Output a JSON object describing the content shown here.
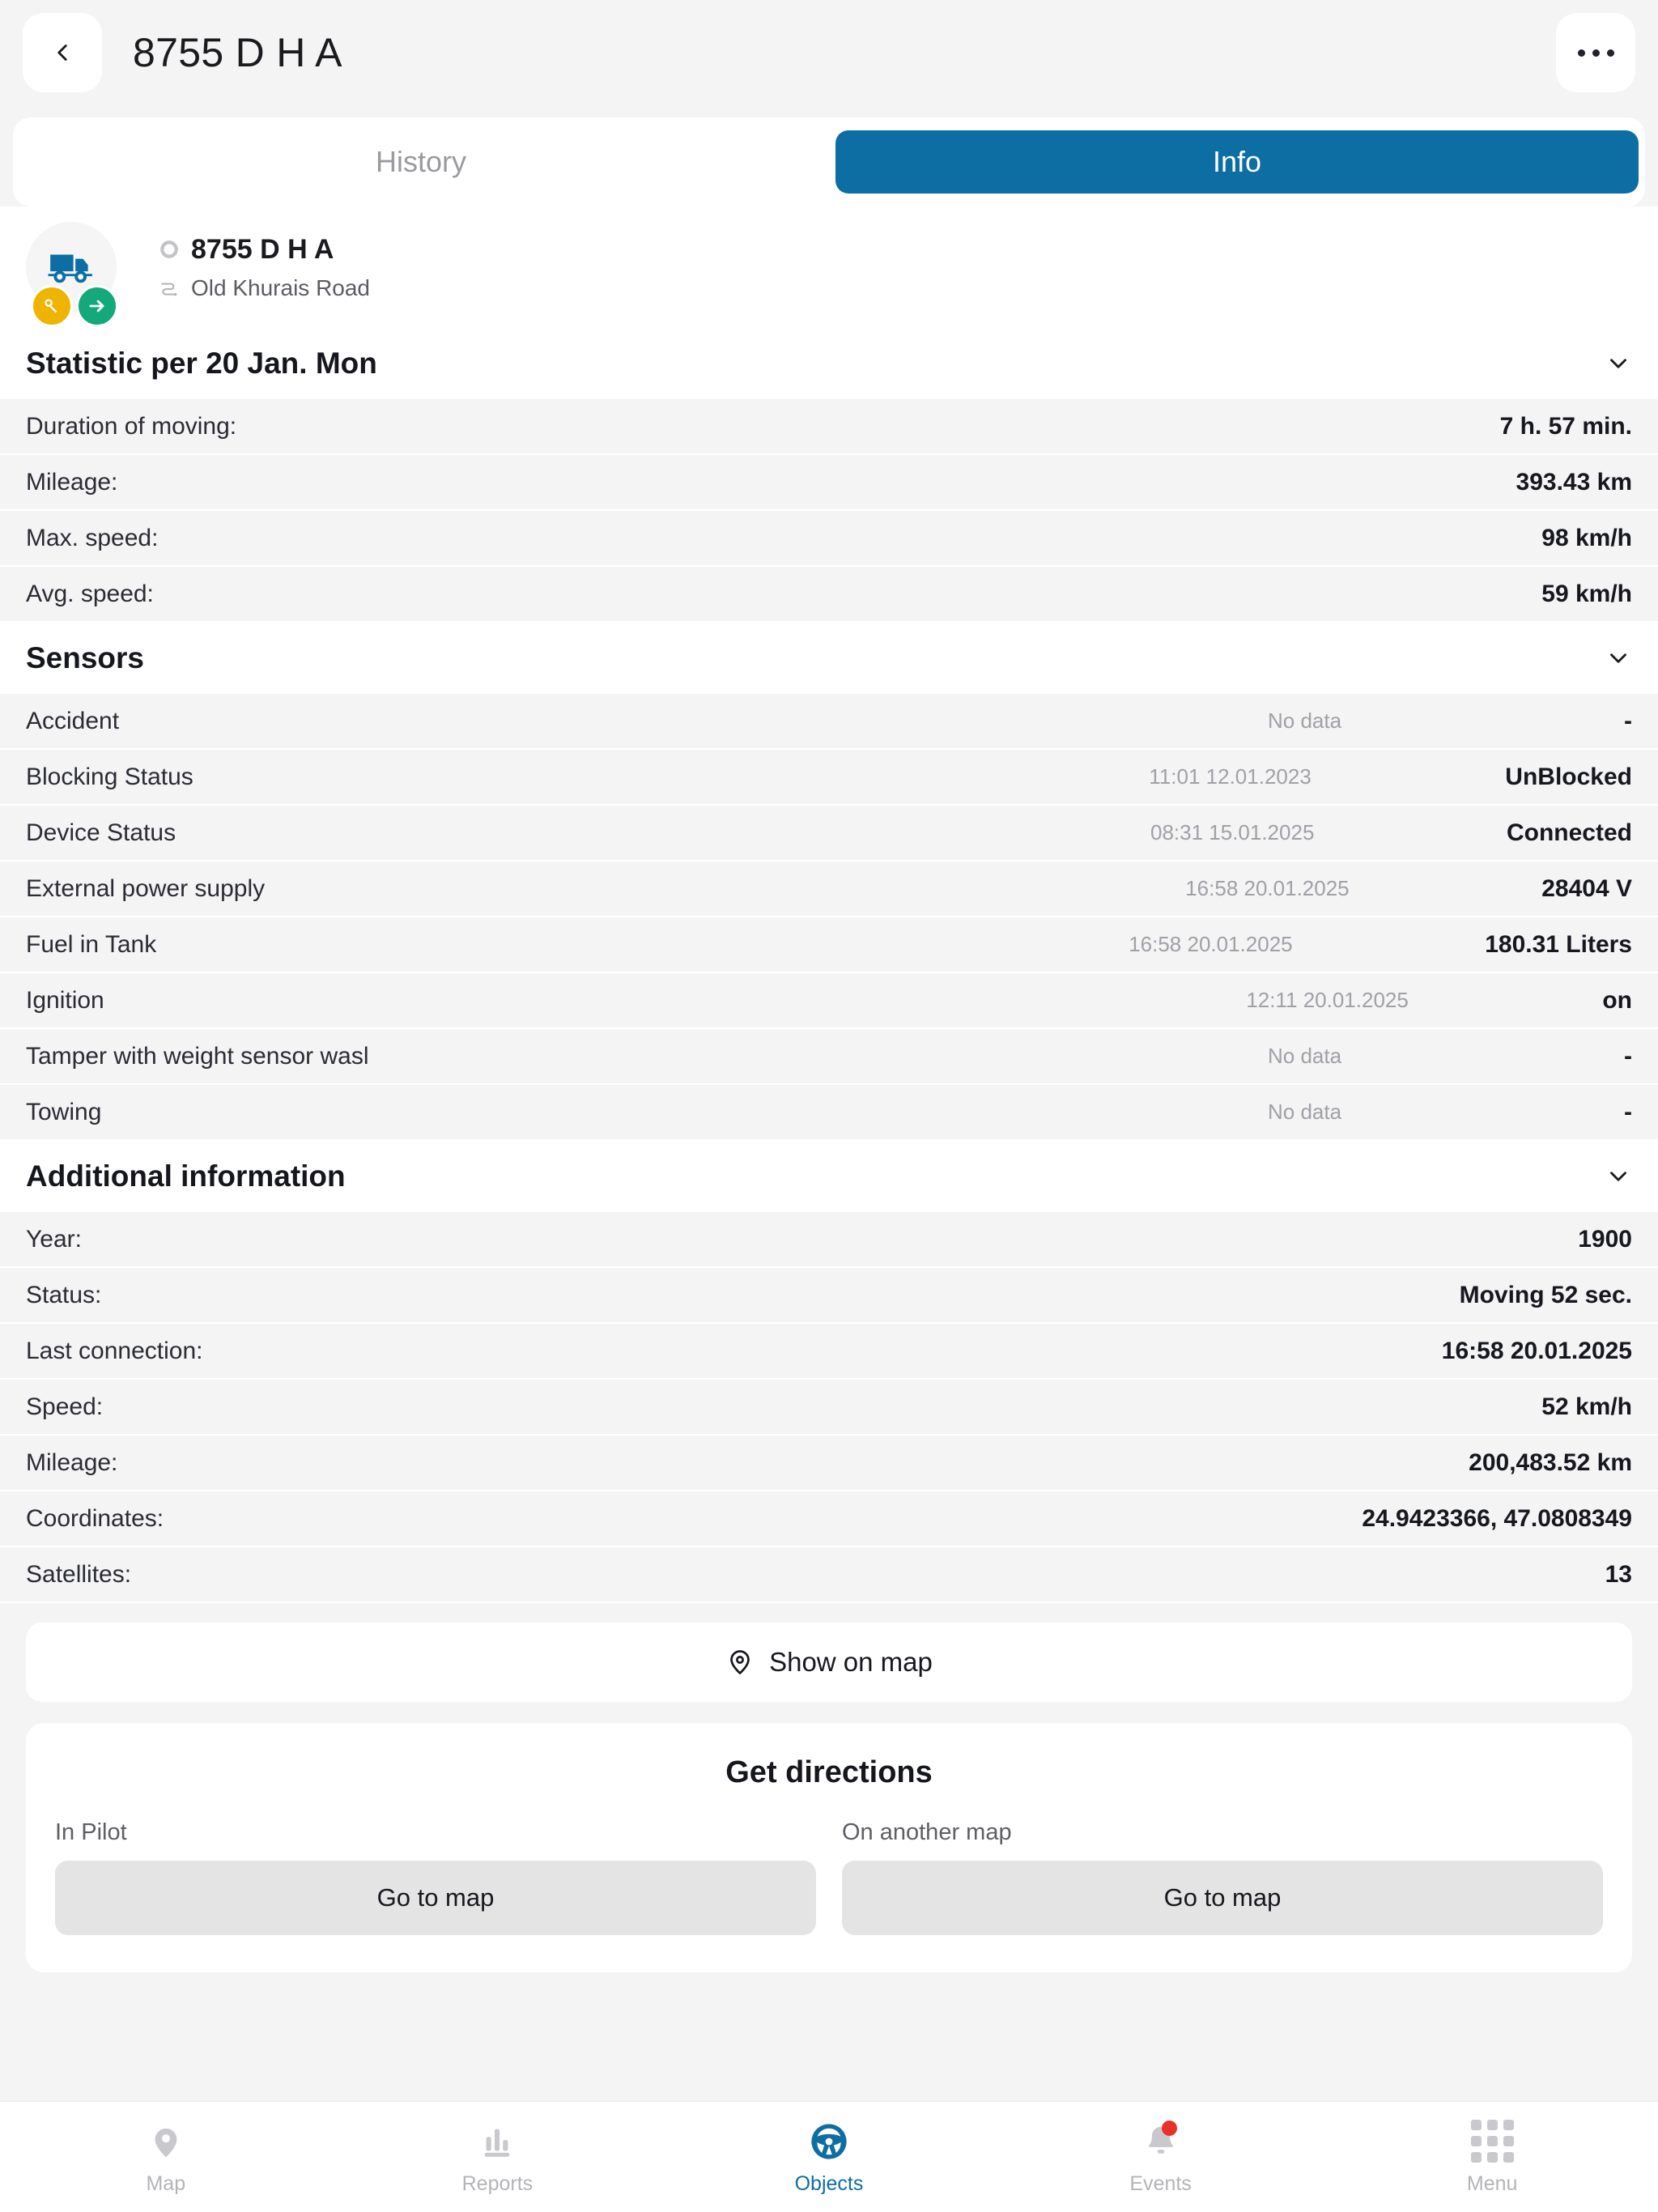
{
  "header": {
    "title": "8755 D H A",
    "back_icon": "chevron-left-icon",
    "more_icon": "more-horizontal-icon"
  },
  "tabs": [
    {
      "label": "History",
      "active": false
    },
    {
      "label": "Info",
      "active": true
    }
  ],
  "object_card": {
    "icon": "truck-icon",
    "badges": [
      {
        "name": "key-icon",
        "color": "#efb400"
      },
      {
        "name": "arrow-right-icon",
        "color": "#13a97a"
      }
    ],
    "status_icon": "circle-icon",
    "name": "8755 D H A",
    "address_icon": "route-icon",
    "address": "Old Khurais Road"
  },
  "statistic": {
    "title": "Statistic per 20 Jan. Mon",
    "rows": [
      {
        "label": "Duration of moving:",
        "value": "7 h. 57 min."
      },
      {
        "label": "Mileage:",
        "value": "393.43 km"
      },
      {
        "label": "Max. speed:",
        "value": "98 km/h"
      },
      {
        "label": "Avg. speed:",
        "value": "59 km/h"
      }
    ]
  },
  "sensors": {
    "title": "Sensors",
    "rows": [
      {
        "label": "Accident",
        "timestamp": "No data",
        "value": "-"
      },
      {
        "label": "Blocking Status",
        "timestamp": "11:01 12.01.2023",
        "value": "UnBlocked"
      },
      {
        "label": "Device Status",
        "timestamp": "08:31 15.01.2025",
        "value": "Connected"
      },
      {
        "label": "External power supply",
        "timestamp": "16:58 20.01.2025",
        "value": "28404 V"
      },
      {
        "label": "Fuel in Tank",
        "timestamp": "16:58 20.01.2025",
        "value": "180.31 Liters"
      },
      {
        "label": "Ignition",
        "timestamp": "12:11 20.01.2025",
        "value": "on"
      },
      {
        "label": "Tamper with weight sensor wasl",
        "timestamp": "No data",
        "value": "-"
      },
      {
        "label": "Towing",
        "timestamp": "No data",
        "value": "-"
      }
    ]
  },
  "additional": {
    "title": "Additional information",
    "rows": [
      {
        "label": "Year:",
        "value": "1900"
      },
      {
        "label": "Status:",
        "value": "Moving 52 sec."
      },
      {
        "label": "Last connection:",
        "value": "16:58 20.01.2025"
      },
      {
        "label": "Speed:",
        "value": "52 km/h"
      },
      {
        "label": "Mileage:",
        "value": "200,483.52 km"
      },
      {
        "label": "Coordinates:",
        "value": "24.9423366, 47.0808349"
      },
      {
        "label": "Satellites:",
        "value": "13"
      }
    ]
  },
  "show_on_map": {
    "label": "Show on map",
    "icon": "map-pin-icon"
  },
  "directions": {
    "title": "Get directions",
    "options": [
      {
        "label": "In Pilot",
        "button": "Go to map"
      },
      {
        "label": "On another map",
        "button": "Go to map"
      }
    ]
  },
  "bottom_nav": [
    {
      "label": "Map",
      "icon": "map-pin-icon",
      "active": false,
      "badge": false
    },
    {
      "label": "Reports",
      "icon": "bar-chart-icon",
      "active": false,
      "badge": false
    },
    {
      "label": "Objects",
      "icon": "steering-wheel-icon",
      "active": true,
      "badge": false
    },
    {
      "label": "Events",
      "icon": "bell-icon",
      "active": false,
      "badge": true
    },
    {
      "label": "Menu",
      "icon": "grid-icon",
      "active": false,
      "badge": false
    }
  ],
  "colors": {
    "accent": "#0d6ea3",
    "page_bg": "#f4f4f4",
    "row_bg": "#f4f4f5",
    "badge_red": "#e8312a",
    "badge_yellow": "#efb400",
    "badge_green": "#13a97a"
  }
}
